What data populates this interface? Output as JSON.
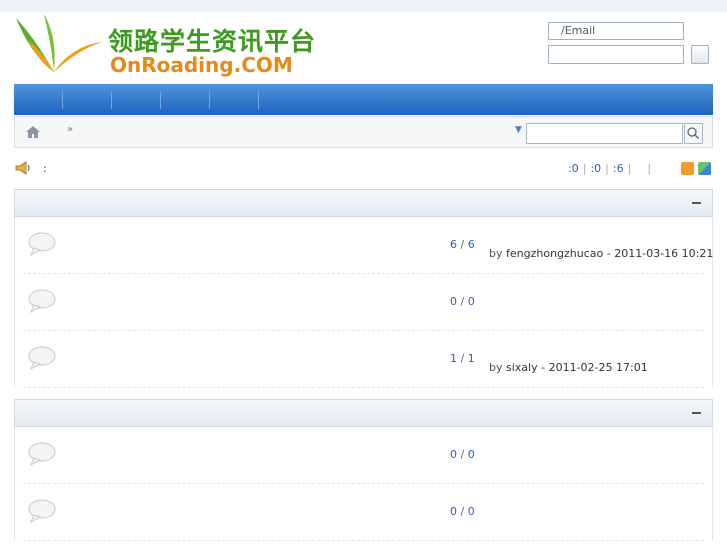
{
  "header": {
    "logo_cn": "领路学生资讯平台",
    "logo_en": "OnRoading.COM",
    "login_user_placeholder": "/Email"
  },
  "breadcrumb": {
    "separator": "»"
  },
  "notice": {
    "colon": ":"
  },
  "stats": {
    "a": ":0",
    "b": ":0",
    "c": ":6",
    "sep": "|"
  },
  "sections": [
    {
      "forums": [
        {
          "topics": "6",
          "posts": "6",
          "by": "by",
          "author": "fengzhongzhucao",
          "time": "2011-03-16 10:21"
        },
        {
          "topics": "0",
          "posts": "0"
        },
        {
          "topics": "1",
          "posts": "1",
          "by": "by",
          "author": "sixaly",
          "time": "2011-02-25 17:01"
        }
      ]
    },
    {
      "forums": [
        {
          "topics": "0",
          "posts": "0"
        },
        {
          "topics": "0",
          "posts": "0"
        }
      ]
    }
  ],
  "colors": {
    "nav": "#2f78cc",
    "logo_green": "#3d9a1f",
    "logo_orange": "#e28a1a",
    "link": "#2a62b0"
  }
}
